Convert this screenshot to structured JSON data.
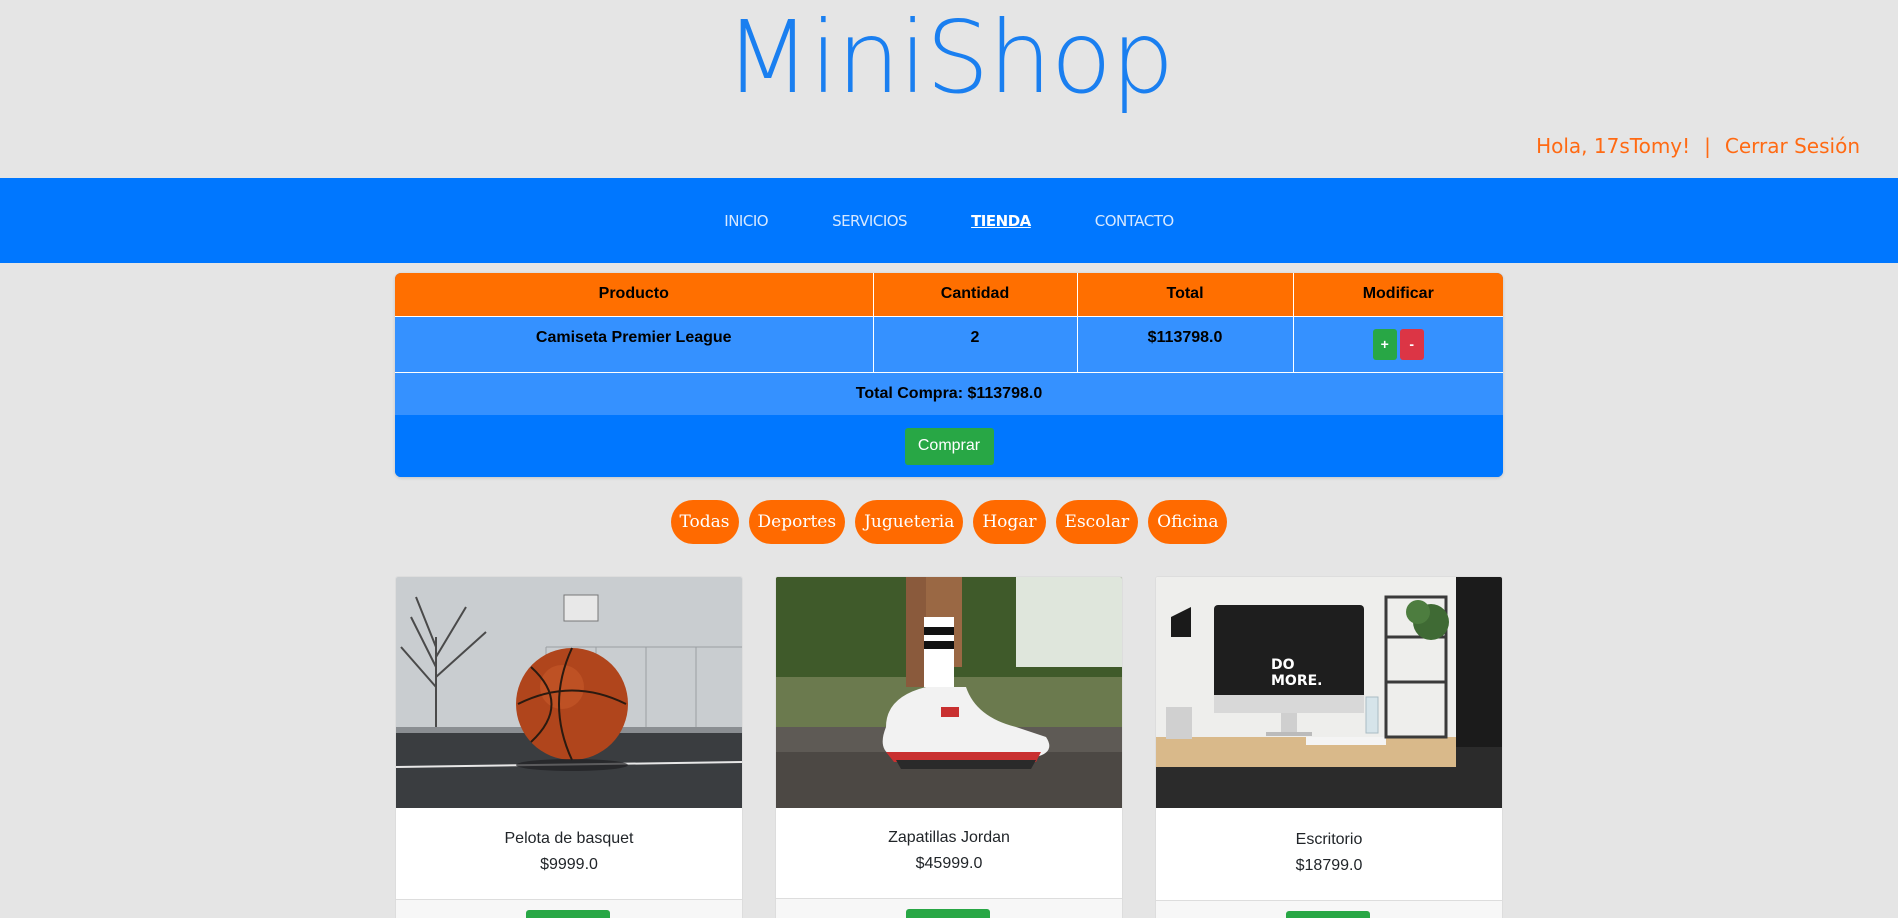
{
  "header": {
    "logo": "MiniShop",
    "greeting": "Hola, 17sTomy!",
    "separator": "|",
    "logout": "Cerrar Sesión"
  },
  "nav": {
    "items": [
      {
        "label": "INICIO"
      },
      {
        "label": "SERVICIOS"
      },
      {
        "label": "TIENDA",
        "active": true
      },
      {
        "label": "CONTACTO"
      }
    ]
  },
  "cart": {
    "headers": [
      "Producto",
      "Cantidad",
      "Total",
      "Modificar"
    ],
    "items": [
      {
        "product": "Camiseta Premier League",
        "quantity": "2",
        "total": "$113798.0",
        "plus": "+",
        "minus": "-"
      }
    ],
    "total_label": "Total Compra: $113798.0",
    "buy_label": "Comprar"
  },
  "categories": [
    "Todas",
    "Deportes",
    "Jugueteria",
    "Hogar",
    "Escolar",
    "Oficina"
  ],
  "products": [
    {
      "name": "Pelota de basquet",
      "price": "$9999.0"
    },
    {
      "name": "Zapatillas Jordan",
      "price": "$45999.0"
    },
    {
      "name": "Escritorio",
      "price": "$18799.0"
    }
  ],
  "colors": {
    "brand_blue": "#0077ff",
    "accent_orange": "#ff6a00",
    "success_green": "#28a745",
    "danger_red": "#dc3545"
  }
}
